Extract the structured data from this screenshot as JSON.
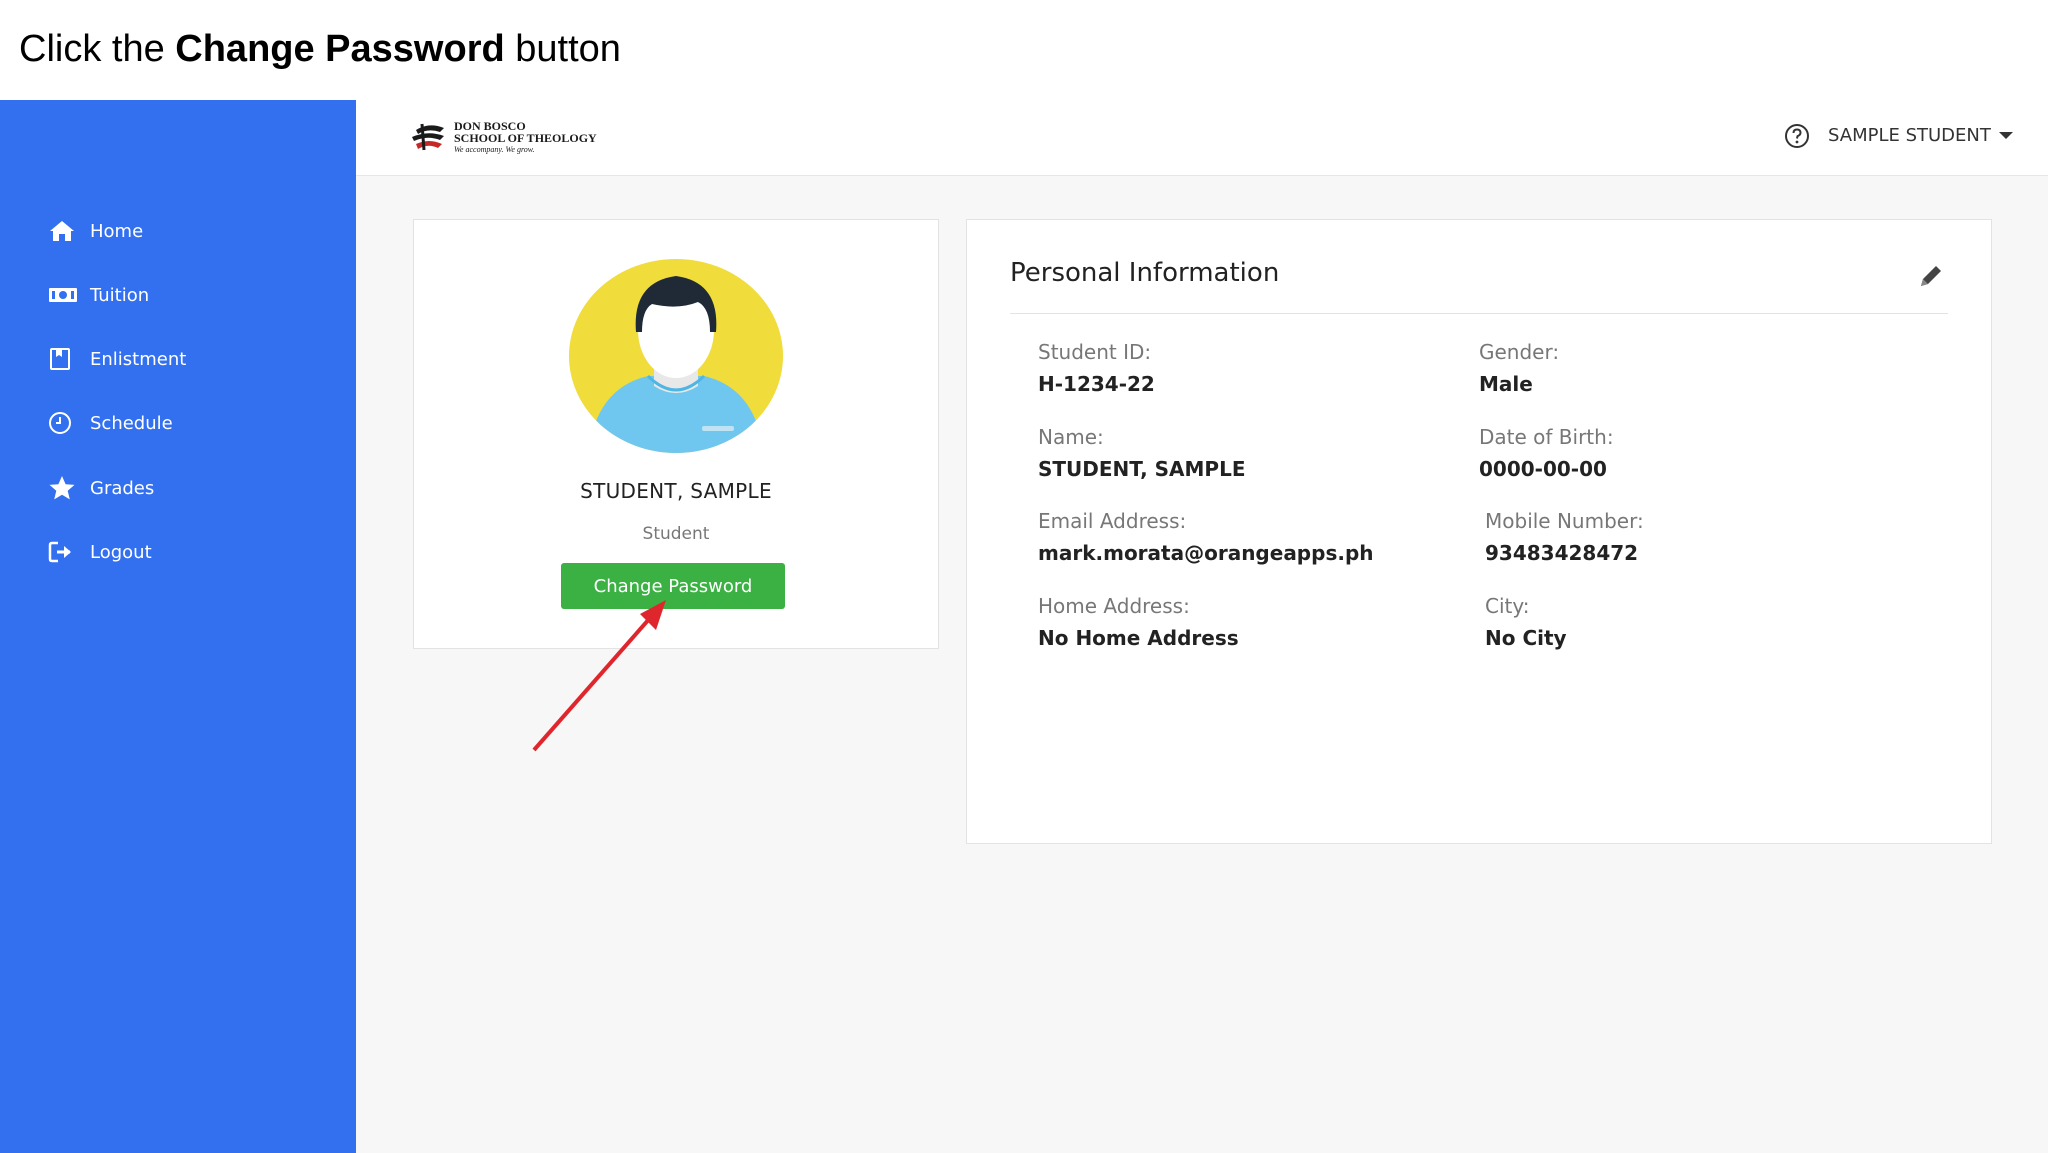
{
  "instruction": {
    "prefix": "Click the ",
    "target": "Change Password",
    "suffix": " button"
  },
  "sidebar": {
    "accent_color": "#3370f0",
    "items": [
      {
        "label": "Home",
        "icon": "home-icon"
      },
      {
        "label": "Tuition",
        "icon": "money-icon"
      },
      {
        "label": "Enlistment",
        "icon": "bookmark-icon"
      },
      {
        "label": "Schedule",
        "icon": "clock-icon"
      },
      {
        "label": "Grades",
        "icon": "star-icon"
      },
      {
        "label": "Logout",
        "icon": "logout-icon"
      }
    ]
  },
  "header": {
    "logo": {
      "line1": "DON BOSCO",
      "line2": "SCHOOL OF THEOLOGY",
      "tagline": "We accompany. We grow."
    },
    "help_icon": "help-icon",
    "user_name": "SAMPLE STUDENT"
  },
  "profile": {
    "name": "STUDENT, SAMPLE",
    "role": "Student",
    "change_password_label": "Change Password",
    "button_color": "#3bb143"
  },
  "personal_info": {
    "title": "Personal Information",
    "fields": [
      {
        "label": "Student ID:",
        "value": "H-1234-22"
      },
      {
        "label": "Gender:",
        "value": "Male"
      },
      {
        "label": "Name:",
        "value": "STUDENT, SAMPLE"
      },
      {
        "label": "Date of Birth:",
        "value": "0000-00-00"
      },
      {
        "label": "Email Address:",
        "value": "mark.morata@orangeapps.ph"
      },
      {
        "label": "Mobile Number:",
        "value": "93483428472"
      },
      {
        "label": "Home Address:",
        "value": "No Home Address"
      },
      {
        "label": "City:",
        "value": "No City"
      }
    ]
  },
  "annotation_color": "#e0262d"
}
